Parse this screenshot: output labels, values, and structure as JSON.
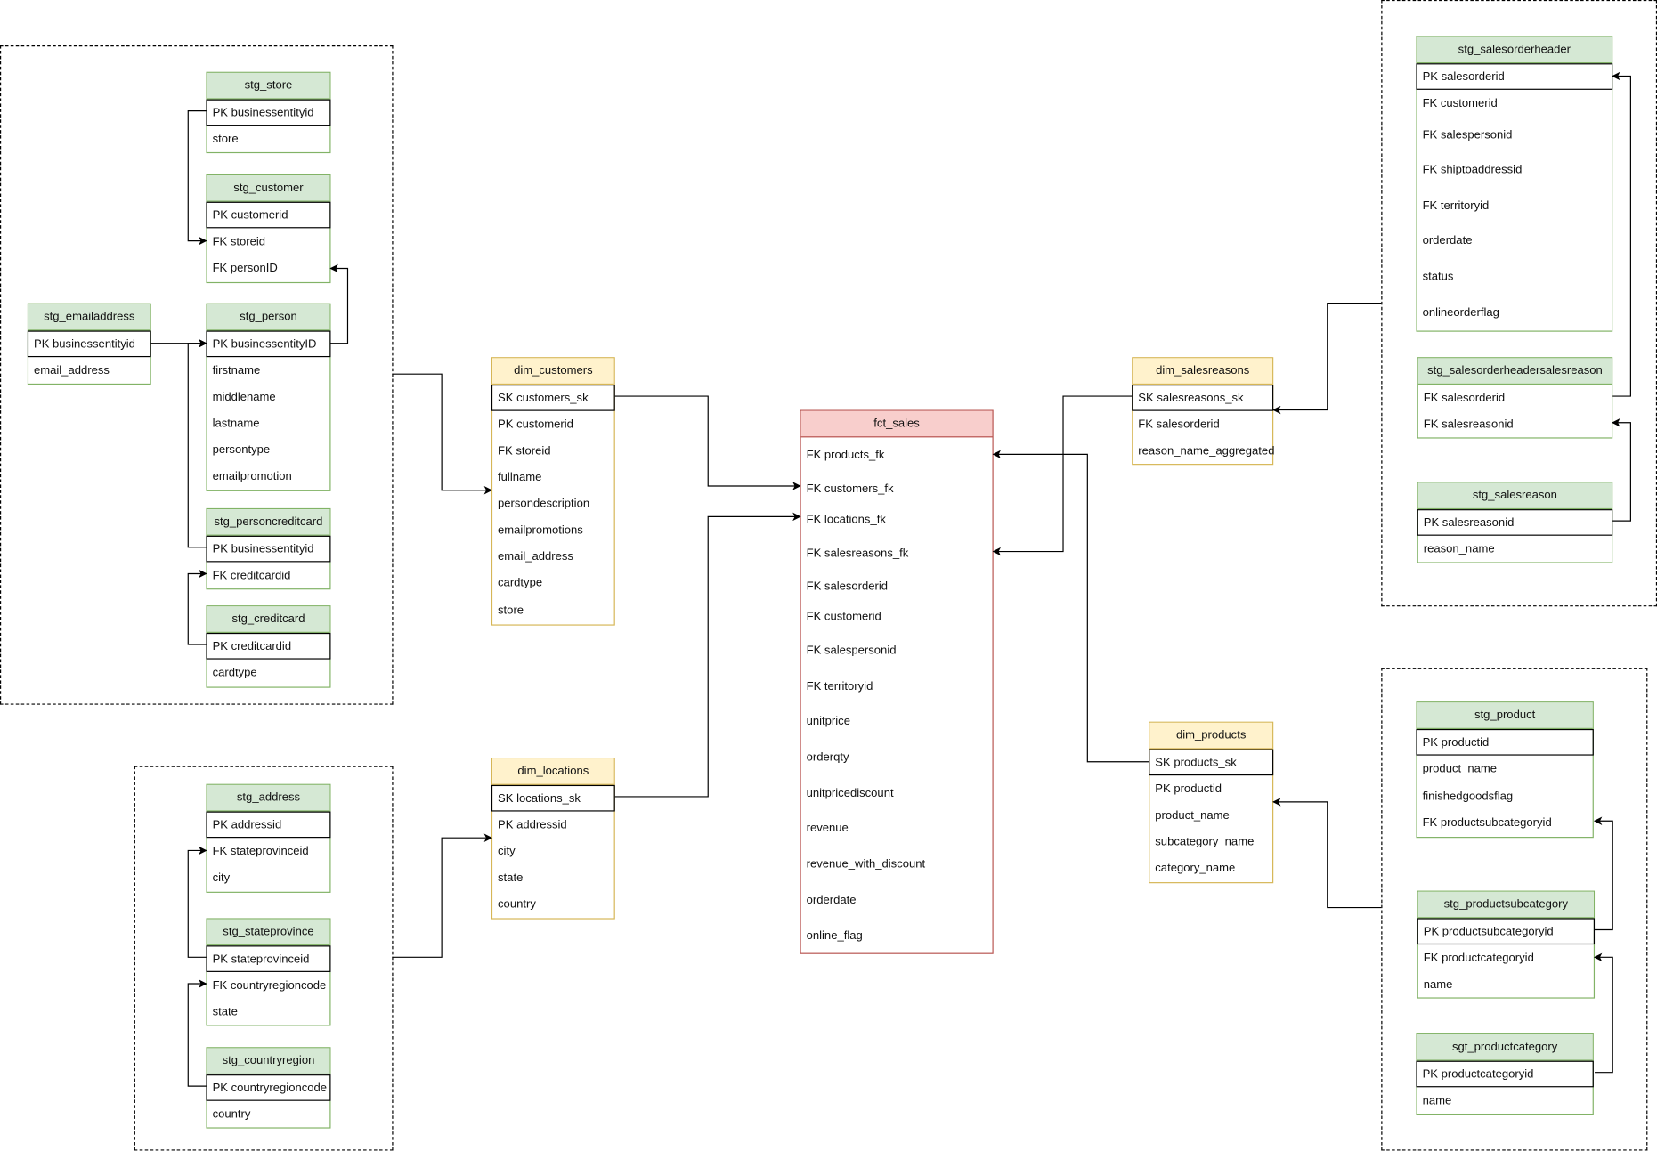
{
  "tables": {
    "stg_store": {
      "title": "stg_store",
      "color": "green",
      "rows": [
        "PK businessentityid",
        "store"
      ]
    },
    "stg_customer": {
      "title": "stg_customer",
      "color": "green",
      "rows": [
        "PK customerid",
        "FK storeid",
        "FK personID"
      ]
    },
    "stg_emailaddress": {
      "title": "stg_emailaddress",
      "color": "green",
      "rows": [
        "PK businessentityid",
        "email_address"
      ]
    },
    "stg_person": {
      "title": "stg_person",
      "color": "green",
      "rows": [
        "PK businessentityID",
        "firstname",
        "middlename",
        "lastname",
        "persontype",
        "emailpromotion"
      ]
    },
    "stg_personcreditcard": {
      "title": "stg_personcreditcard",
      "color": "green",
      "rows": [
        "PK businessentityid",
        "FK creditcardid"
      ]
    },
    "stg_creditcard": {
      "title": "stg_creditcard",
      "color": "green",
      "rows": [
        "PK creditcardid",
        "cardtype"
      ]
    },
    "stg_address": {
      "title": "stg_address",
      "color": "green",
      "rows": [
        "PK addressid",
        "FK stateprovinceid",
        "city"
      ]
    },
    "stg_stateprovince": {
      "title": "stg_stateprovince",
      "color": "green",
      "rows": [
        "PK stateprovinceid",
        "FK countryregioncode",
        "state"
      ]
    },
    "stg_countryregion": {
      "title": "stg_countryregion",
      "color": "green",
      "rows": [
        "PK countryregioncode",
        "country"
      ]
    },
    "dim_customers": {
      "title": "dim_customers",
      "color": "yellow",
      "rows": [
        "SK customers_sk",
        "PK customerid",
        "FK storeid",
        "fullname",
        "persondescription",
        "emailpromotions",
        "email_address",
        "cardtype",
        "store"
      ]
    },
    "dim_locations": {
      "title": "dim_locations",
      "color": "yellow",
      "rows": [
        "SK locations_sk",
        "PK addressid",
        "city",
        "state",
        "country"
      ]
    },
    "fct_sales": {
      "title": "fct_sales",
      "color": "red",
      "rows": [
        "FK products_fk",
        "FK customers_fk",
        "FK locations_fk",
        "FK salesreasons_fk",
        "FK salesorderid",
        "FK customerid",
        "FK salespersonid",
        "FK territoryid",
        "unitprice",
        "orderqty",
        "unitpricediscount",
        "revenue",
        "revenue_with_discount",
        "orderdate",
        "online_flag"
      ]
    },
    "dim_salesreasons": {
      "title": "dim_salesreasons",
      "color": "yellow",
      "rows": [
        "SK salesreasons_sk",
        "FK salesorderid",
        "reason_name_aggregated"
      ]
    },
    "dim_products": {
      "title": "dim_products",
      "color": "yellow",
      "rows": [
        "SK products_sk",
        "PK productid",
        "product_name",
        "subcategory_name",
        "category_name"
      ]
    },
    "stg_salesorderheader": {
      "title": "stg_salesorderheader",
      "color": "green",
      "rows": [
        "PK salesorderid",
        "FK customerid",
        "FK salespersonid",
        "FK shiptoaddressid",
        "FK territoryid",
        "orderdate",
        "status",
        "onlineorderflag"
      ]
    },
    "stg_salesorderheadersalesreason": {
      "title": "stg_salesorderheadersalesreason",
      "color": "green",
      "rows": [
        "FK salesorderid",
        "FK salesreasonid"
      ]
    },
    "stg_salesreason": {
      "title": "stg_salesreason",
      "color": "green",
      "rows": [
        "PK salesreasonid",
        "reason_name"
      ]
    },
    "stg_product": {
      "title": "stg_product",
      "color": "green",
      "rows": [
        "PK productid",
        "product_name",
        "finishedgoodsflag",
        "FK productsubcategoryid"
      ]
    },
    "stg_productsubcategory": {
      "title": "stg_productsubcategory",
      "color": "green",
      "rows": [
        "PK productsubcategoryid",
        "FK productcategoryid",
        "name"
      ]
    },
    "sgt_productcategory": {
      "title": "sgt_productcategory",
      "color": "green",
      "rows": [
        "PK productcategoryid",
        "name"
      ]
    }
  }
}
